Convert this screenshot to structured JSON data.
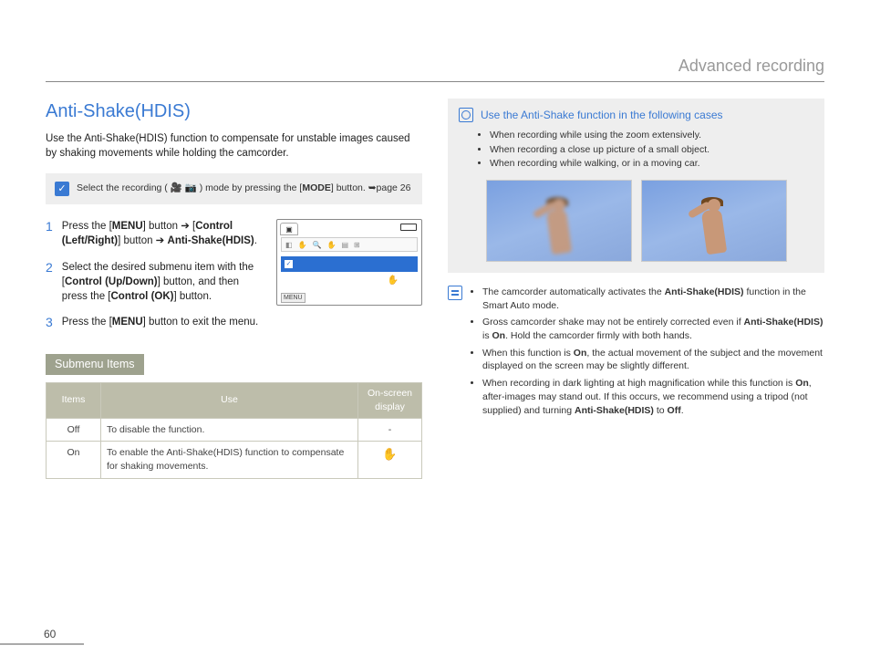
{
  "header": {
    "title": "Advanced recording"
  },
  "section": {
    "title": "Anti-Shake(HDIS)",
    "intro": "Use the Anti-Shake(HDIS) function to compensate for unstable images caused by shaking movements while holding the camcorder."
  },
  "modebox": {
    "prefix": "Select the recording ( ",
    "suffix": " ) mode by pressing the [",
    "mode": "MODE",
    "tail": "] button. ➥page 26"
  },
  "steps": [
    {
      "num": "1",
      "parts": [
        "Press the [",
        "MENU",
        "] button ➔ [",
        "Control (Left/Right)",
        "] button ➔ ",
        "Anti-Shake(HDIS)",
        "."
      ]
    },
    {
      "num": "2",
      "parts": [
        "Select the desired submenu item with the [",
        "Control (Up/Down)",
        "] button, and then press the [",
        "Control (OK)",
        "] button."
      ]
    },
    {
      "num": "3",
      "parts": [
        "Press the [",
        "MENU",
        "] button to exit the menu."
      ]
    }
  ],
  "submenu": {
    "badge": "Submenu Items",
    "headers": [
      "Items",
      "Use",
      "On-screen display"
    ],
    "rows": [
      {
        "item": "Off",
        "use": "To disable the function.",
        "display": "-"
      },
      {
        "item": "On",
        "use": "To enable the Anti-Shake(HDIS) function to compensate for shaking movements.",
        "display": "✋"
      }
    ]
  },
  "usecases": {
    "title": "Use the Anti-Shake function in the following cases",
    "items": [
      "When recording while using the zoom extensively.",
      "When recording a close up picture of a small object.",
      "When recording while walking, or in a moving car."
    ]
  },
  "notes": {
    "items": [
      {
        "pre": "The camcorder automatically activates the ",
        "b1": "Anti-Shake(HDIS)",
        "post": " function in the Smart Auto mode."
      },
      {
        "pre": "Gross camcorder shake may not be entirely corrected even if ",
        "b1": "Anti-Shake(HDIS)",
        "mid": " is ",
        "b2": "On",
        "post": ". Hold the camcorder firmly with both hands."
      },
      {
        "pre": "When this function is ",
        "b1": "On",
        "post": ", the actual movement of the subject and the movement displayed on the screen may be slightly different."
      },
      {
        "pre": "When recording in dark lighting at high magnification while this function is ",
        "b1": "On",
        "mid": ", after-images may stand out. If this occurs, we recommend using a tripod (not supplied) and turning ",
        "b2": "Anti-Shake(HDIS)",
        "mid2": " to ",
        "b3": "Off",
        "post": "."
      }
    ]
  },
  "page_number": "60",
  "icons": {
    "video": "🎥",
    "camera": "📷",
    "hand": "✋"
  }
}
